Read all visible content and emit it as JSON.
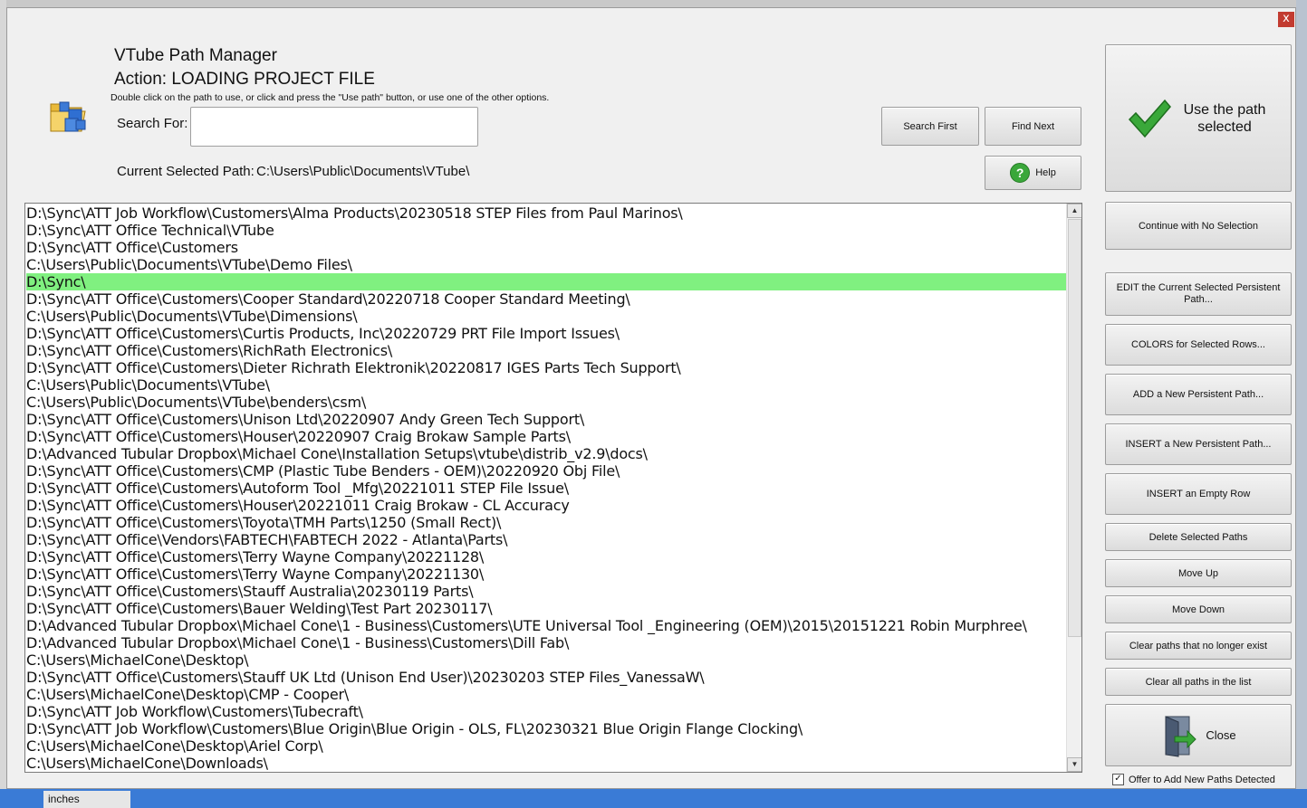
{
  "window": {
    "title": "VTube Path Manager",
    "action": "Action: LOADING PROJECT FILE",
    "hint": "Double click on the path to use, or click and press the \"Use path\" button, or use one of the other options.",
    "close_glyph": "x"
  },
  "search": {
    "label": "Search For:",
    "value": "",
    "search_first_label": "Search First",
    "find_next_label": "Find Next",
    "help_label": "Help",
    "help_glyph": "?"
  },
  "current_path": {
    "label": "Current Selected Path:",
    "value": "C:\\Users\\Public\\Documents\\VTube\\"
  },
  "use_path": {
    "label": "Use the path selected",
    "icon": "checkmark-icon"
  },
  "paths": [
    "D:\\Sync\\ATT Job Workflow\\Customers\\Alma Products\\20230518 STEP Files from Paul Marinos\\",
    "D:\\Sync\\ATT Office Technical\\VTube",
    "D:\\Sync\\ATT Office\\Customers",
    "C:\\Users\\Public\\Documents\\VTube\\Demo Files\\",
    "D:\\Sync\\",
    "D:\\Sync\\ATT Office\\Customers\\Cooper Standard\\20220718 Cooper Standard Meeting\\",
    "C:\\Users\\Public\\Documents\\VTube\\Dimensions\\",
    "D:\\Sync\\ATT Office\\Customers\\Curtis Products, Inc\\20220729 PRT File Import Issues\\",
    "D:\\Sync\\ATT Office\\Customers\\RichRath Electronics\\",
    "D:\\Sync\\ATT Office\\Customers\\Dieter Richrath Elektronik\\20220817 IGES Parts Tech Support\\",
    "C:\\Users\\Public\\Documents\\VTube\\",
    "C:\\Users\\Public\\Documents\\VTube\\benders\\csm\\",
    "D:\\Sync\\ATT Office\\Customers\\Unison Ltd\\20220907 Andy Green Tech Support\\",
    "D:\\Sync\\ATT Office\\Customers\\Houser\\20220907 Craig Brokaw Sample Parts\\",
    "D:\\Advanced Tubular Dropbox\\Michael Cone\\Installation Setups\\vtube\\distrib_v2.9\\docs\\",
    "D:\\Sync\\ATT Office\\Customers\\CMP (Plastic Tube Benders - OEM)\\20220920 Obj File\\",
    "D:\\Sync\\ATT Office\\Customers\\Autoform Tool _Mfg\\20221011 STEP File Issue\\",
    "D:\\Sync\\ATT Office\\Customers\\Houser\\20221011 Craig Brokaw - CL Accuracy",
    "D:\\Sync\\ATT Office\\Customers\\Toyota\\TMH Parts\\1250 (Small Rect)\\",
    "D:\\Sync\\ATT Office\\Vendors\\FABTECH\\FABTECH 2022 - Atlanta\\Parts\\",
    "D:\\Sync\\ATT Office\\Customers\\Terry Wayne Company\\20221128\\",
    "D:\\Sync\\ATT Office\\Customers\\Terry Wayne Company\\20221130\\",
    "D:\\Sync\\ATT Office\\Customers\\Stauff Australia\\20230119 Parts\\",
    "D:\\Sync\\ATT Office\\Customers\\Bauer Welding\\Test Part 20230117\\",
    "D:\\Advanced Tubular Dropbox\\Michael Cone\\1 - Business\\Customers\\UTE Universal Tool _Engineering (OEM)\\2015\\20151221 Robin Murphree\\",
    "D:\\Advanced Tubular Dropbox\\Michael Cone\\1 - Business\\Customers\\Dill Fab\\",
    "C:\\Users\\MichaelCone\\Desktop\\",
    "D:\\Sync\\ATT Office\\Customers\\Stauff UK Ltd (Unison End User)\\20230203 STEP Files_VanessaW\\",
    "C:\\Users\\MichaelCone\\Desktop\\CMP - Cooper\\",
    "D:\\Sync\\ATT Job Workflow\\Customers\\Tubecraft\\",
    "D:\\Sync\\ATT Job Workflow\\Customers\\Blue Origin\\Blue Origin - OLS, FL\\20230321 Blue Origin Flange Clocking\\",
    "C:\\Users\\MichaelCone\\Desktop\\Ariel Corp\\",
    "C:\\Users\\MichaelCone\\Downloads\\"
  ],
  "selected_index": 4,
  "selected_color": "#80f080",
  "side_buttons": {
    "continue": "Continue with No Selection",
    "edit": "EDIT the Current Selected Persistent Path...",
    "colors": "COLORS for Selected Rows...",
    "add": "ADD a New Persistent Path...",
    "insert": "INSERT a New Persistent Path...",
    "insert_empty": "INSERT an Empty Row",
    "delete": "Delete Selected Paths",
    "move_up": "Move Up",
    "move_down": "Move Down",
    "clear_missing": "Clear paths that no longer exist",
    "clear_all": "Clear all paths in the list",
    "close": "Close"
  },
  "offer": {
    "label": "Offer to Add New Paths Detected",
    "checked": true,
    "check_glyph": "✓"
  },
  "background": {
    "units_label": "inches"
  }
}
